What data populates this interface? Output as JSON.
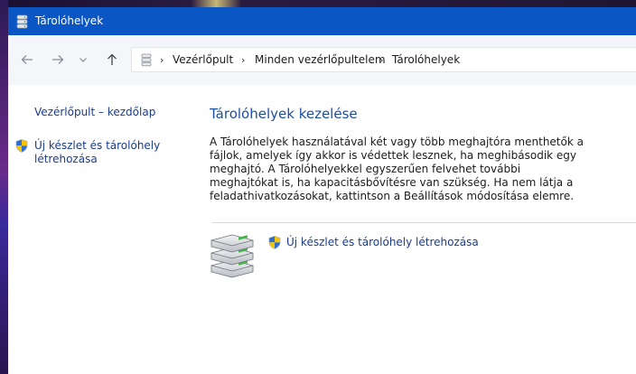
{
  "window": {
    "title": "Tárolóhelyek"
  },
  "navigation": {
    "back_icon": "arrow-left-icon",
    "forward_icon": "arrow-right-icon",
    "recent_icon": "chevron-down-icon",
    "up_icon": "arrow-up-icon"
  },
  "address_bar": {
    "icon": "storage-spaces-icon",
    "breadcrumbs": [
      "Vezérlőpult",
      "Minden vezérlőpultelem",
      "Tárolóhelyek"
    ]
  },
  "sidebar": {
    "home_link": "Vezérlőpult – kezdőlap",
    "create_link_line1": "Új készlet és tárolóhely",
    "create_link_line2": "létrehozása"
  },
  "main": {
    "title": "Tárolóhelyek kezelése",
    "description": "A Tárolóhelyek használatával két vagy több meghajtóra menthetők a fájlok, amelyek így akkor is védettek lesznek, ha meghibásodik egy meghajtó. A Tárolóhelyekkel egyszerűen felvehet további meghajtókat is, ha kapacitásbővítésre van szükség. Ha nem látja a feladathivatkozásokat, kattintson a Beállítások módosítása elemre.",
    "action_link": "Új készlet és tárolóhely létrehozása"
  },
  "colors": {
    "titlebar": "#0a56c5",
    "link": "#1a3c8c",
    "heading": "#1e4fa0"
  }
}
